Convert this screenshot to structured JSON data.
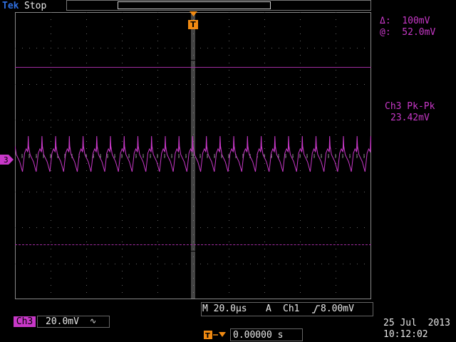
{
  "top_bar": {
    "brand": "Tek",
    "run_state": "Stop"
  },
  "trigger": {
    "marker_label": "T"
  },
  "channel_marker": {
    "label": "3"
  },
  "cursors": {
    "delta_text": "Δ:  100mV",
    "at_text": "@:  52.0mV"
  },
  "measurement": {
    "label": "Ch3 Pk-Pk",
    "value": "23.42mV"
  },
  "bottom_bar": {
    "channel": "Ch3",
    "scale": "20.0mV",
    "coupling_symbol": "∿",
    "timebase": "M 20.0µs",
    "trigger_mode": "A",
    "trigger_source": "Ch1",
    "trigger_level": "8.00mV",
    "horizontal_position": "0.00000 s",
    "date": "25 Jul  2013",
    "time": "10:12:02"
  },
  "waveform": {
    "color": "#c838c8",
    "cycles": 26
  },
  "colors": {
    "accent_trigger": "#f08a12",
    "channel3": "#c838c8",
    "brand": "#2f6fe0"
  }
}
